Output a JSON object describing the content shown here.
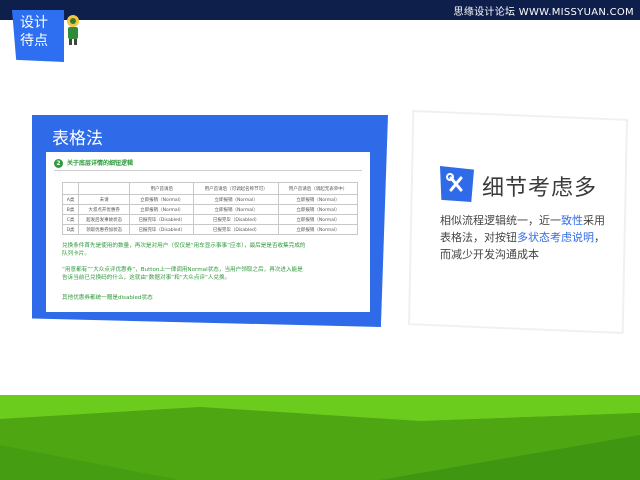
{
  "watermark": "思缘设计论坛 WWW.MISSYUAN.COM",
  "tag": {
    "label": "设计\n待点"
  },
  "panel": {
    "title": "表格法",
    "doc": {
      "heading_num": "2",
      "heading": "关于底层详情的细钮逻辑",
      "table": {
        "headers": [
          "",
          "",
          "用户首请后",
          "用户首请后（可调起名称节可）",
          "用户首请后（调起无表单中）"
        ],
        "rows": [
          [
            "A类",
            "未请",
            "立即报销（Normal）",
            "立即报销（Normal）",
            "立即报销（Normal）"
          ],
          [
            "B类",
            "大叔点开优惠券",
            "立即报销（Normal）",
            "立即报销（Normal）",
            "立即报销（Normal）"
          ],
          [
            "C类",
            "超发后发事故状态",
            "已报完毕（Disabled）",
            "已报完毕（Disabled）",
            "立即报销（Normal）"
          ],
          [
            "D类",
            "领取优惠券加状态",
            "已报完毕（Disabled）",
            "已报完毕（Disabled）",
            "立即报销（Normal）"
          ]
        ]
      },
      "note1": "兑换条件首先是使用的数量，再次是对用户（仅仅是“用车显示事事”应本），最后是是否收集完成的\n队列卡片。",
      "note2": "“用意都有”“大众点评优惠券”，Button上一律调用Normal状态，当用户领取之后，再次进入能是\n告诉当前已兑换码的什么，这就由“数据对事”和“大众点评”人兑换。",
      "note3": "其他优惠券都统一赠是disabled状态"
    }
  },
  "card": {
    "title": "细节考虑多",
    "body_pre": "相似流程逻辑统一，近一",
    "body_hl1": "致性",
    "body_mid1": "采用表格法，对按钮",
    "body_hl2": "多状态考虑说明",
    "body_post": "，而减少开发沟通成本"
  },
  "colors": {
    "accent": "#2f6ae8",
    "topbar": "#0f1f4b",
    "green": "#5cb818",
    "note_green": "#2e9a3a"
  }
}
